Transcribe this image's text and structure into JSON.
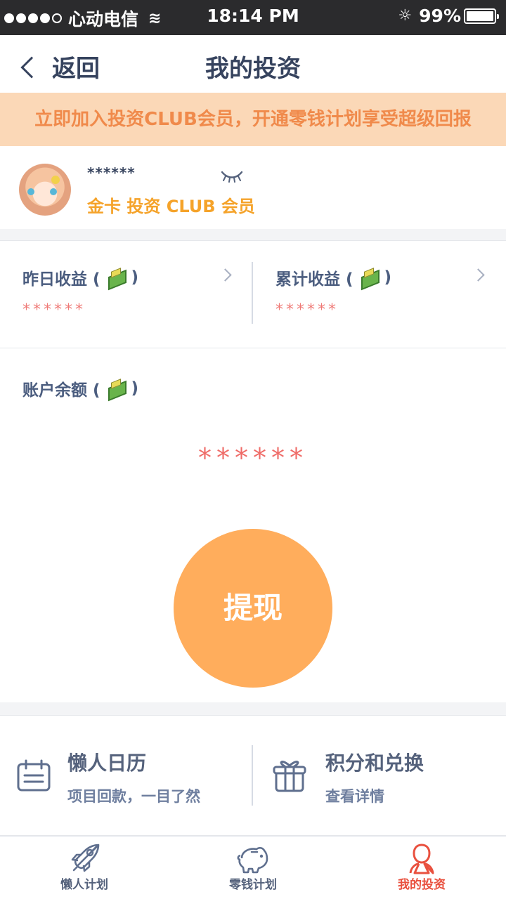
{
  "status_bar": {
    "carrier": "心动电信",
    "time": "18:14 PM",
    "battery": "99%",
    "battery_level": 0.99
  },
  "nav": {
    "back_label": "返回",
    "title": "我的投资"
  },
  "banner": {
    "text": "立即加入投资CLUB会员，开通零钱计划享受超级回报"
  },
  "profile": {
    "masked_name": "******",
    "membership": "金卡 投资 CLUB 会员"
  },
  "income": {
    "yesterday_label_prefix": "昨日收益 (",
    "yesterday_label_suffix": ")",
    "yesterday_value": "******",
    "total_label_prefix": "累计收益 (",
    "total_label_suffix": ")",
    "total_value": "******"
  },
  "balance": {
    "label_prefix": "账户余额 (",
    "label_suffix": ")",
    "value": "******",
    "withdraw_label": "提现"
  },
  "features": {
    "calendar_title": "懒人日历",
    "calendar_subtitle": "项目回款，一目了然",
    "points_title": "积分和兑换",
    "points_subtitle": "查看详情"
  },
  "tabs": [
    {
      "label": "懒人计划",
      "icon": "rocket-icon"
    },
    {
      "label": "零钱计划",
      "icon": "piggy-bank-icon"
    },
    {
      "label": "我的投资",
      "icon": "user-icon",
      "active": true
    }
  ],
  "colors": {
    "accent": "#ffad5c",
    "active_tab": "#e9513f",
    "masked_value": "#ef7a77",
    "banner_background": "#fbd8b7"
  }
}
